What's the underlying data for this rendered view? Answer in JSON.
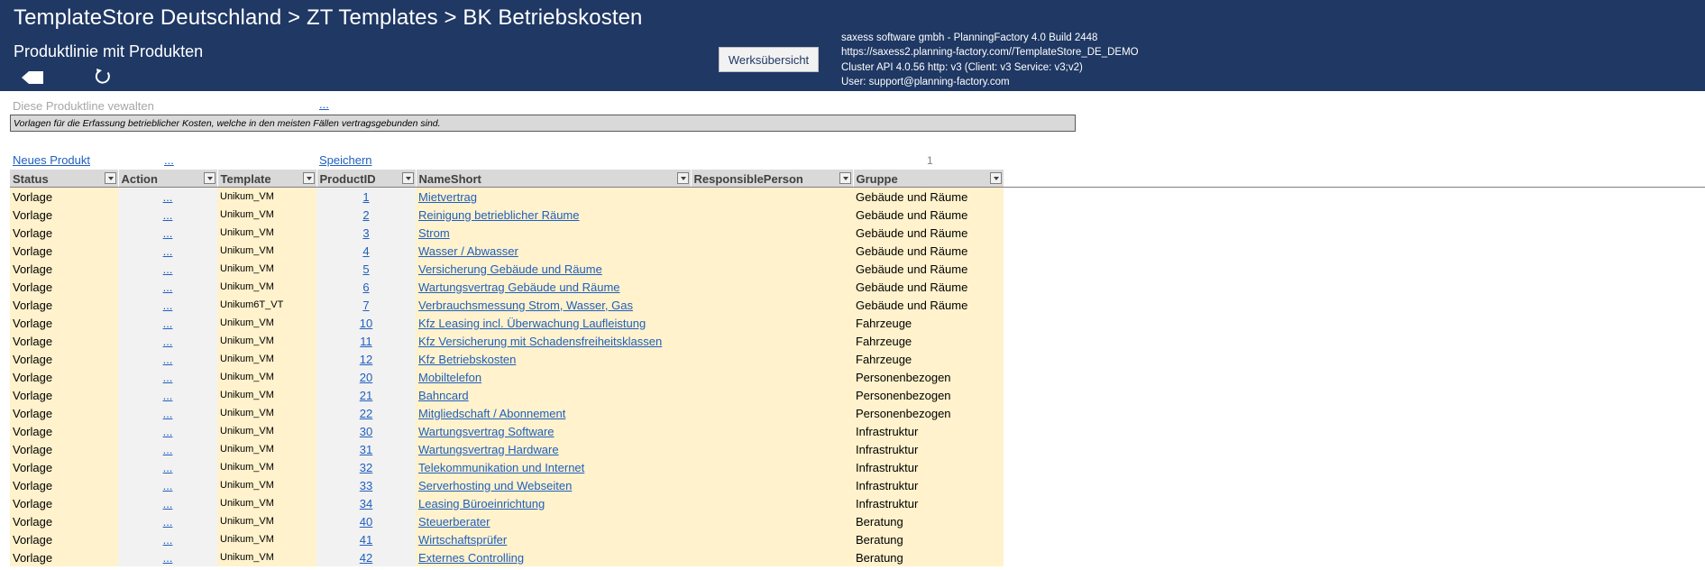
{
  "header": {
    "title": "TemplateStore Deutschland > ZT  Templates > BK  Betriebskosten",
    "subtitle": "Produktlinie mit Produkten",
    "werks_button": "Werksübersicht",
    "info": [
      "saxess software gmbh - PlanningFactory 4.0 Build 2448",
      "https://saxess2.planning-factory.com//TemplateStore_DE_DEMO",
      "Cluster API 4.0.56 http: v3 (Client: v3 Service: v3;v2)",
      "User: support@planning-factory.com"
    ],
    "icons": {
      "back": "back-arrow-icon",
      "refresh": "refresh-icon"
    },
    "bg_color": "#1f3864"
  },
  "manage": {
    "label": "Diese Produktline vewalten",
    "dots": "..."
  },
  "description": "Vorlagen für die Erfassung betrieblicher Kosten, welche in den meisten Fällen vertragsgebunden sind.",
  "toolbar": {
    "new_product": "Neues Produkt",
    "action_dots": "...",
    "save": "Speichern",
    "page": "1"
  },
  "table": {
    "columns": [
      "Status",
      "Action",
      "Template",
      "ProductID",
      "NameShort",
      "ResponsiblePerson",
      "Gruppe"
    ],
    "rows": [
      {
        "status": "Vorlage",
        "action": "...",
        "template": "Unikum_VM",
        "id": "1",
        "name": "Mietvertrag",
        "person": "",
        "group": "Gebäude und Räume"
      },
      {
        "status": "Vorlage",
        "action": "...",
        "template": "Unikum_VM",
        "id": "2",
        "name": "Reinigung betrieblicher Räume",
        "person": "",
        "group": "Gebäude und Räume"
      },
      {
        "status": "Vorlage",
        "action": "...",
        "template": "Unikum_VM",
        "id": "3",
        "name": "Strom",
        "person": "",
        "group": "Gebäude und Räume"
      },
      {
        "status": "Vorlage",
        "action": "...",
        "template": "Unikum_VM",
        "id": "4",
        "name": "Wasser / Abwasser",
        "person": "",
        "group": "Gebäude und Räume"
      },
      {
        "status": "Vorlage",
        "action": "...",
        "template": "Unikum_VM",
        "id": "5",
        "name": "Versicherung Gebäude und Räume",
        "person": "",
        "group": "Gebäude und Räume"
      },
      {
        "status": "Vorlage",
        "action": "...",
        "template": "Unikum_VM",
        "id": "6",
        "name": "Wartungsvertrag Gebäude und Räume",
        "person": "",
        "group": "Gebäude und Räume"
      },
      {
        "status": "Vorlage",
        "action": "...",
        "template": "Unikum6T_VT",
        "id": "7",
        "name": "Verbrauchsmessung Strom, Wasser, Gas",
        "person": "",
        "group": "Gebäude und Räume"
      },
      {
        "status": "Vorlage",
        "action": "...",
        "template": "Unikum_VM",
        "id": "10",
        "name": "Kfz Leasing incl. Überwachung Laufleistung",
        "person": "",
        "group": "Fahrzeuge"
      },
      {
        "status": "Vorlage",
        "action": "...",
        "template": "Unikum_VM",
        "id": "11",
        "name": "Kfz Versicherung mit Schadensfreiheitsklassen",
        "person": "",
        "group": "Fahrzeuge"
      },
      {
        "status": "Vorlage",
        "action": "...",
        "template": "Unikum_VM",
        "id": "12",
        "name": "Kfz Betriebskosten",
        "person": "",
        "group": "Fahrzeuge"
      },
      {
        "status": "Vorlage",
        "action": "...",
        "template": "Unikum_VM",
        "id": "20",
        "name": "Mobiltelefon",
        "person": "",
        "group": "Personenbezogen"
      },
      {
        "status": "Vorlage",
        "action": "...",
        "template": "Unikum_VM",
        "id": "21",
        "name": "Bahncard",
        "person": "",
        "group": "Personenbezogen"
      },
      {
        "status": "Vorlage",
        "action": "...",
        "template": "Unikum_VM",
        "id": "22",
        "name": "Mitgliedschaft / Abonnement",
        "person": "",
        "group": "Personenbezogen"
      },
      {
        "status": "Vorlage",
        "action": "...",
        "template": "Unikum_VM",
        "id": "30",
        "name": "Wartungsvertrag Software",
        "person": "",
        "group": "Infrastruktur"
      },
      {
        "status": "Vorlage",
        "action": "...",
        "template": "Unikum_VM",
        "id": "31",
        "name": "Wartungsvertrag Hardware",
        "person": "",
        "group": "Infrastruktur"
      },
      {
        "status": "Vorlage",
        "action": "...",
        "template": "Unikum_VM",
        "id": "32",
        "name": "Telekommunikation und Internet",
        "person": "",
        "group": "Infrastruktur"
      },
      {
        "status": "Vorlage",
        "action": "...",
        "template": "Unikum_VM",
        "id": "33",
        "name": "Serverhosting und Webseiten",
        "person": "",
        "group": "Infrastruktur"
      },
      {
        "status": "Vorlage",
        "action": "...",
        "template": "Unikum_VM",
        "id": "34",
        "name": "Leasing Büroeinrichtung",
        "person": "",
        "group": "Infrastruktur"
      },
      {
        "status": "Vorlage",
        "action": "...",
        "template": "Unikum_VM",
        "id": "40",
        "name": "Steuerberater",
        "person": "",
        "group": "Beratung"
      },
      {
        "status": "Vorlage",
        "action": "...",
        "template": "Unikum_VM",
        "id": "41",
        "name": "Wirtschaftsprüfer",
        "person": "",
        "group": "Beratung"
      },
      {
        "status": "Vorlage",
        "action": "...",
        "template": "Unikum_VM",
        "id": "42",
        "name": "Externes Controlling",
        "person": "",
        "group": "Beratung"
      }
    ]
  },
  "colors": {
    "cell_yellow": "#fff2cc",
    "cell_gray": "#f2f2f2",
    "link": "#1f5fbf",
    "header_gray": "#d9d9d9"
  }
}
